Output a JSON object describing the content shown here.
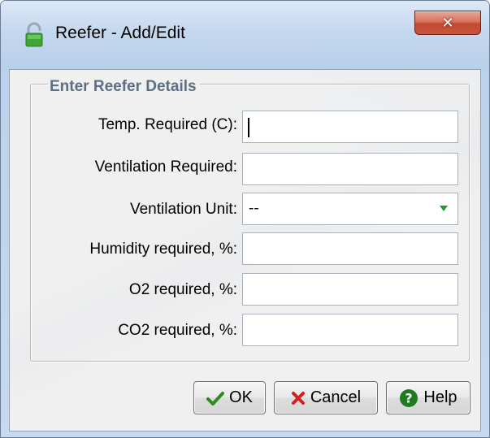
{
  "window": {
    "title": "Reefer - Add/Edit",
    "close_glyph": "✕"
  },
  "form": {
    "legend": "Enter Reefer Details",
    "fields": [
      {
        "label": "Temp. Required (C):",
        "value": "",
        "type": "text"
      },
      {
        "label": "Ventilation Required:",
        "value": "",
        "type": "text"
      },
      {
        "label": "Ventilation Unit:",
        "value": "--",
        "type": "select"
      },
      {
        "label": "Humidity required, %:",
        "value": "",
        "type": "text"
      },
      {
        "label": "O2 required, %:",
        "value": "",
        "type": "text"
      },
      {
        "label": "CO2 required, %:",
        "value": "",
        "type": "text"
      }
    ]
  },
  "buttons": {
    "ok": "OK",
    "cancel": "Cancel",
    "help": "Help"
  },
  "colors": {
    "ok_icon": "#2e8b1e",
    "cancel_icon": "#d42020",
    "help_icon": "#1f7a22",
    "select_arrow": "#1a9c2a"
  },
  "icons": {
    "window": "padlock-icon",
    "ok": "checkmark-icon",
    "cancel": "x-mark-icon",
    "help": "question-circle-icon"
  }
}
